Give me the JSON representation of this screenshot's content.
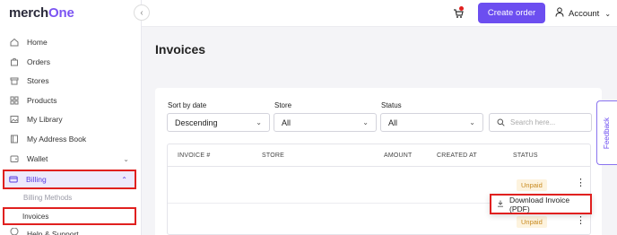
{
  "brand": {
    "name_part1": "merch",
    "name_part2": "One"
  },
  "sidebar": {
    "items": [
      {
        "label": "Home",
        "icon": "home-icon"
      },
      {
        "label": "Orders",
        "icon": "bag-icon"
      },
      {
        "label": "Stores",
        "icon": "store-icon"
      },
      {
        "label": "Products",
        "icon": "grid-icon"
      },
      {
        "label": "My Library",
        "icon": "image-icon"
      },
      {
        "label": "My Address Book",
        "icon": "book-icon"
      },
      {
        "label": "Wallet",
        "icon": "wallet-icon"
      },
      {
        "label": "Billing",
        "icon": "card-icon"
      }
    ],
    "billing_sub": [
      {
        "label": "Billing Methods"
      },
      {
        "label": "Invoices"
      }
    ],
    "cut_item": "Help & Support"
  },
  "topbar": {
    "create_order": "Create order",
    "account": "Account",
    "cart_badge_color": "#e0201f"
  },
  "page": {
    "title": "Invoices"
  },
  "filters": {
    "sort_label": "Sort by date",
    "sort_value": "Descending",
    "store_label": "Store",
    "store_value": "All",
    "status_label": "Status",
    "status_value": "All",
    "search_placeholder": "Search here..."
  },
  "table": {
    "headers": [
      "INVOICE #",
      "STORE",
      "AMOUNT",
      "CREATED AT",
      "STATUS"
    ],
    "rows": [
      {
        "status": "Unpaid"
      },
      {
        "status": "Unpaid"
      }
    ]
  },
  "dropdown": {
    "download_label": "Download Invoice (PDF)"
  },
  "feedback": {
    "label": "Feedback"
  },
  "colors": {
    "accent": "#6c4ef0",
    "highlight": "#e0201f",
    "unpaid": "#c88a1f"
  }
}
